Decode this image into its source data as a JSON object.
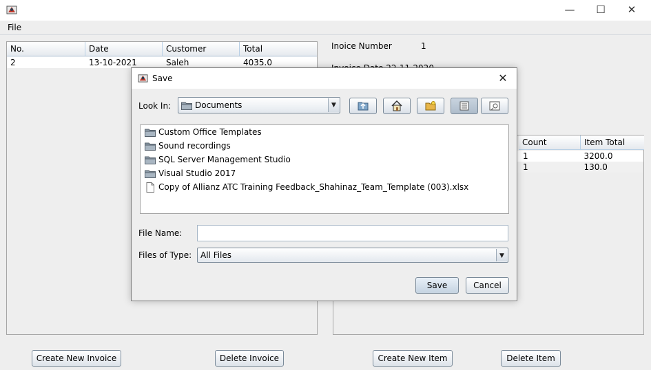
{
  "window": {
    "minimize": "—",
    "maximize": "☐",
    "close": "✕"
  },
  "menu": {
    "file": "File"
  },
  "invoices": {
    "columns": [
      "No.",
      "Date",
      "Customer",
      "Total"
    ],
    "rows": [
      [
        "2",
        "13-10-2021",
        "Saleh",
        "4035.0"
      ]
    ]
  },
  "details": {
    "invoice_number_label": "Inoice Number",
    "invoice_number_value": "1",
    "invoice_date_partial": "Invoice Date  22-11-2020"
  },
  "items": {
    "columns": [
      "Count",
      "Item Total"
    ],
    "rows": [
      [
        "1",
        "3200.0"
      ],
      [
        "1",
        "130.0"
      ]
    ]
  },
  "buttons": {
    "create_invoice": "Create New Invoice",
    "delete_invoice": "Delete Invoice",
    "create_item": "Create New Item",
    "delete_item": "Delete Item"
  },
  "dialog": {
    "title": "Save",
    "close": "✕",
    "look_in_label": "Look In:",
    "look_in_value": "Documents",
    "files": [
      {
        "name": "Custom Office Templates",
        "icon": "folder-icon"
      },
      {
        "name": "Sound recordings",
        "icon": "folder-icon"
      },
      {
        "name": "SQL Server Management Studio",
        "icon": "folder-icon"
      },
      {
        "name": "Visual Studio 2017",
        "icon": "folder-icon"
      },
      {
        "name": "Copy of Allianz ATC Training Feedback_Shahinaz_Team_Template (003).xlsx",
        "icon": "file-icon"
      }
    ],
    "file_name_label": "File Name:",
    "file_name_value": "",
    "file_type_label": "Files of Type:",
    "file_type_value": "All Files",
    "save": "Save",
    "cancel": "Cancel"
  },
  "colors": {
    "accent": "#7a8a99",
    "header_border": "#b8cfe5",
    "folder": "#6f7f8f"
  }
}
